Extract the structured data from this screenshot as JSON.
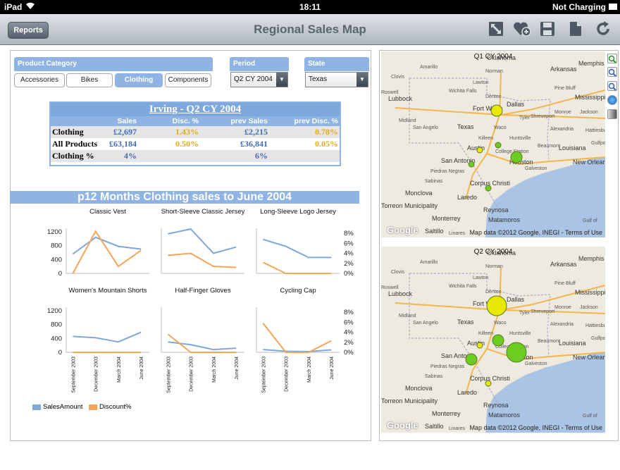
{
  "status": {
    "device": "iPad",
    "wifi_icon": "wifi-icon",
    "time": "18:11",
    "battery": "Not Charging"
  },
  "nav": {
    "back_label": "Reports",
    "title": "Regional Sales Map",
    "icons": [
      "fullscreen-icon",
      "favorite-icon",
      "save-icon",
      "document-icon",
      "refresh-icon"
    ]
  },
  "filters": {
    "category_header": "Product Category",
    "categories": [
      "Accessories",
      "Bikes",
      "Clothing",
      "Components"
    ],
    "selected_category": "Clothing",
    "period_header": "Period",
    "period_value": "Q2 CY 2004",
    "state_header": "State",
    "state_value": "Texas"
  },
  "summary": {
    "title": "Irving  -  Q2 CY 2004",
    "columns": [
      "Sales",
      "Disc. %",
      "prev Sales",
      "prev Disc. %"
    ],
    "rows": [
      {
        "label": "Clothing",
        "sales": "£2,697",
        "disc": "1.43%",
        "prev_sales": "£2,215",
        "prev_disc": "0.78%"
      },
      {
        "label": "All Products",
        "sales": "£63,184",
        "disc": "0.50%",
        "prev_sales": "£36,841",
        "prev_disc": "0.05%"
      },
      {
        "label": "Clothing %",
        "sales": "4%",
        "disc": "",
        "prev_sales": "6%",
        "prev_disc": ""
      }
    ]
  },
  "trend": {
    "title": "p12 Months Clothing sales to June 2004",
    "legend": [
      {
        "label": "SalesAmount",
        "color": "#7ea7db"
      },
      {
        "label": "Discount%",
        "color": "#f5a55a"
      }
    ]
  },
  "chart_data": {
    "type": "line",
    "x": [
      "September 2003",
      "December 2003",
      "March 2004",
      "June 2004"
    ],
    "left_axis": {
      "ticks": [
        "1200",
        "800",
        "400",
        "0"
      ],
      "ylim": [
        0,
        1300
      ]
    },
    "right_axis": {
      "ticks": [
        "8%",
        "6%",
        "4%",
        "2%",
        "0%"
      ],
      "ylim": [
        0,
        9
      ]
    },
    "panels": [
      {
        "title": "Classic Vest",
        "sales": [
          560,
          1040,
          780,
          700
        ],
        "discount": [
          0,
          8.4,
          1.4,
          4.6
        ]
      },
      {
        "title": "Short-Sleeve Classic Jersey",
        "sales": [
          1140,
          1280,
          580,
          760
        ],
        "discount": [
          3.6,
          4.0,
          1.4,
          1.2
        ]
      },
      {
        "title": "Long-Sleeve Logo Jersey",
        "sales": [
          980,
          780,
          460,
          460
        ],
        "discount": [
          2.2,
          0,
          0,
          0
        ]
      },
      {
        "title": "Women's Mountain Shorts",
        "sales": [
          460,
          420,
          300,
          580
        ],
        "discount": [
          0,
          0,
          0,
          0
        ]
      },
      {
        "title": "Half-Finger Gloves",
        "sales": [
          300,
          220,
          80,
          120
        ],
        "discount": [
          3.6,
          0,
          0,
          0
        ]
      },
      {
        "title": "Cycling Cap",
        "sales": [
          80,
          30,
          20,
          70
        ],
        "discount": [
          5.8,
          0,
          0,
          2.3
        ]
      }
    ]
  },
  "maps": [
    {
      "title": "Q1 CY 2004",
      "attribution": "Map data ©2012 Google, INEGI - Terms of Use"
    },
    {
      "title": "Q2 CY 2004",
      "attribution": "Map data ©2012 Google, INEGI - Terms of Use"
    }
  ],
  "map_labels": [
    "Oklahoma",
    "Arkansas",
    "Texas",
    "Louisiana",
    "Dallas",
    "Fort Worth",
    "Austin",
    "Houston",
    "San Antonio",
    "Corpus Christi",
    "Monterrey",
    "Laredo",
    "Reynosa",
    "Matamoros",
    "Amarillo",
    "Lubbock",
    "Midland",
    "Shreveport",
    "Jackson",
    "Memphis",
    "New Orleans",
    "Galveston",
    "Waco",
    "Killeen",
    "Huntsville",
    "Beaumont",
    "Alexandria",
    "Monroe",
    "Tyler",
    "Norman",
    "Lawton",
    "Wichita Falls",
    "Denton",
    "Clovis",
    "Roswell",
    "San Angelo",
    "Piedras Negras",
    "Sabinas",
    "Monclova",
    "Torreon Municipality",
    "Saltillo",
    "Linares",
    "Pine Bluff",
    "Mississippi",
    "Hattiesburg",
    "Gulfport",
    "College Station",
    "Gulf of"
  ],
  "map_markers": {
    "q1": [
      {
        "city": "Dallas",
        "size": "medium",
        "color": "#e8e800"
      },
      {
        "city": "Austin",
        "size": "small",
        "color": "#e8e800"
      },
      {
        "city": "College Station",
        "size": "small",
        "color": "#6ccc22"
      },
      {
        "city": "Houston",
        "size": "medium",
        "color": "#6ccc22"
      },
      {
        "city": "San Antonio",
        "size": "small",
        "color": "#6ccc22"
      },
      {
        "city": "Corpus Christi",
        "size": "small",
        "color": "#6ccc22"
      }
    ],
    "q2": [
      {
        "city": "Dallas",
        "size": "large",
        "color": "#e8e800"
      },
      {
        "city": "Austin",
        "size": "small",
        "color": "#e8e800"
      },
      {
        "city": "College Station",
        "size": "medium",
        "color": "#6ccc22"
      },
      {
        "city": "Houston",
        "size": "large",
        "color": "#6ccc22"
      },
      {
        "city": "San Antonio",
        "size": "medium",
        "color": "#6ccc22"
      },
      {
        "city": "Corpus Christi",
        "size": "small",
        "color": "#e8e800"
      }
    ]
  },
  "colors": {
    "accent": "#8fb4e3",
    "sales_line": "#7ea7db",
    "discount_line": "#f5a55a"
  }
}
